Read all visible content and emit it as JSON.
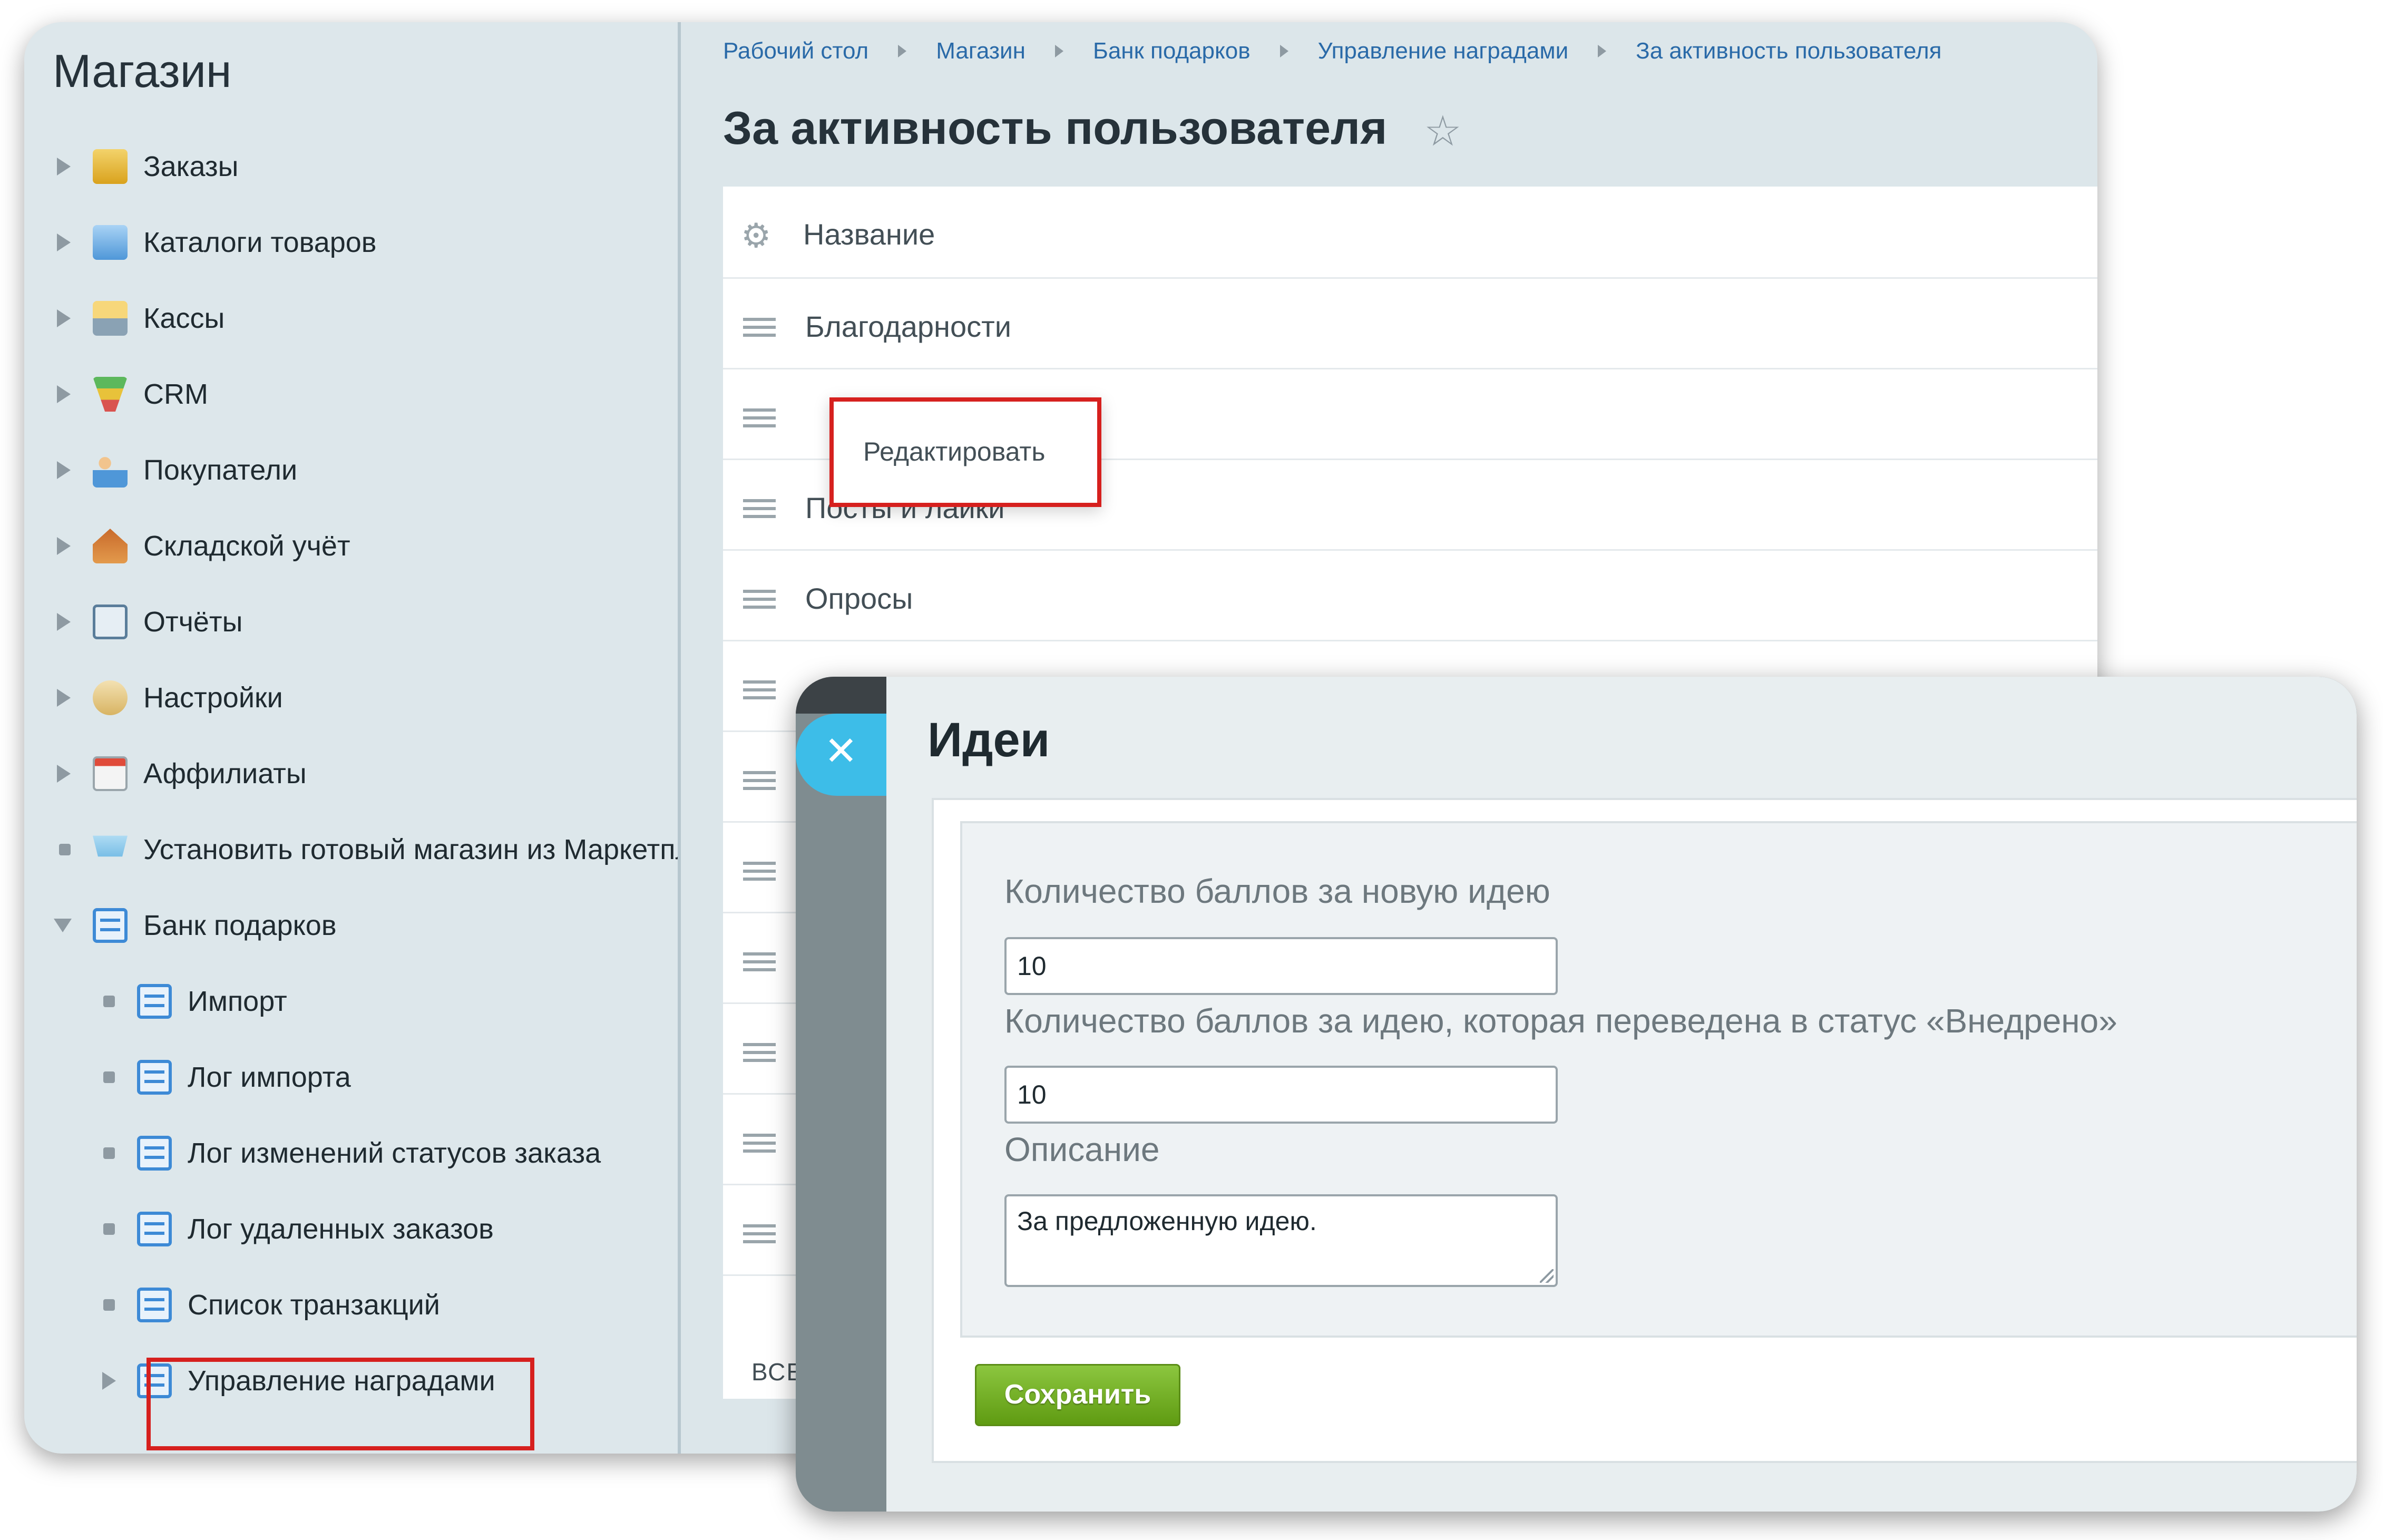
{
  "sidebar": {
    "title": "Магазин",
    "items": [
      {
        "label": "Заказы",
        "icon": "orders-bag-icon",
        "marker": "arrow"
      },
      {
        "label": "Каталоги товаров",
        "icon": "folder-icon",
        "marker": "arrow"
      },
      {
        "label": "Кассы",
        "icon": "cash-register-icon",
        "marker": "arrow"
      },
      {
        "label": "CRM",
        "icon": "crm-funnel-icon",
        "marker": "arrow"
      },
      {
        "label": "Покупатели",
        "icon": "customers-icon",
        "marker": "arrow"
      },
      {
        "label": "Складской учёт",
        "icon": "warehouse-icon",
        "marker": "arrow"
      },
      {
        "label": "Отчёты",
        "icon": "reports-icon",
        "marker": "arrow"
      },
      {
        "label": "Настройки",
        "icon": "settings-icon",
        "marker": "arrow"
      },
      {
        "label": "Аффилиаты",
        "icon": "affiliates-icon",
        "marker": "arrow"
      },
      {
        "label": "Установить готовый магазин из Маркетплейса",
        "icon": "shopping-cart-icon",
        "marker": "dot"
      },
      {
        "label": "Банк подарков",
        "icon": "document-icon",
        "marker": "arrow-down"
      }
    ],
    "sub_items": [
      {
        "label": "Импорт",
        "marker": "dot"
      },
      {
        "label": "Лог импорта",
        "marker": "dot"
      },
      {
        "label": "Лог изменений статусов заказа",
        "marker": "dot"
      },
      {
        "label": "Лог удаленных заказов",
        "marker": "dot"
      },
      {
        "label": "Список транзакций",
        "marker": "dot"
      },
      {
        "label": "Управление наградами",
        "marker": "arrow",
        "highlighted": true
      }
    ]
  },
  "breadcrumb": [
    "Рабочий стол",
    "Магазин",
    "Банк подарков",
    "Управление наградами",
    "За активность пользователя"
  ],
  "page": {
    "title": "За активность пользователя",
    "column_header": "Название",
    "rows": [
      "Благодарности",
      "",
      "Посты и лайки",
      "Опросы",
      "",
      "",
      "",
      "",
      "",
      "",
      ""
    ],
    "context_menu_item": "Редактировать",
    "footer_text": "ВСЕГ"
  },
  "dialog": {
    "title": "Идеи",
    "fields": {
      "new_idea_label": "Количество баллов за новую идею",
      "new_idea_value": "10",
      "implemented_label": "Количество баллов за идею, которая переведена в статус «Внедрено»",
      "implemented_value": "10",
      "description_label": "Описание",
      "description_value": "За предложенную идею."
    },
    "save_label": "Сохранить"
  },
  "colors": {
    "accent_link": "#2a6aa8",
    "highlight_red": "#d6201e",
    "save_green": "#6aab1c",
    "close_blue": "#3dbde8"
  }
}
